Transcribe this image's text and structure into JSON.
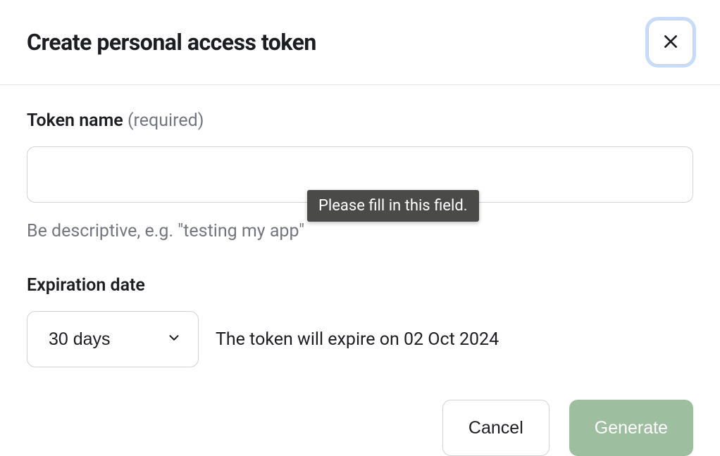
{
  "modal": {
    "title": "Create personal access token"
  },
  "fields": {
    "token_name": {
      "label": "Token name",
      "required_hint": "(required)",
      "value": "",
      "helper": "Be descriptive, e.g. \"testing my app\""
    },
    "expiration": {
      "label": "Expiration date",
      "selected": "30 days",
      "note": "The token will expire on 02 Oct 2024"
    }
  },
  "validation": {
    "message": "Please fill in this field."
  },
  "actions": {
    "cancel": "Cancel",
    "generate": "Generate"
  }
}
